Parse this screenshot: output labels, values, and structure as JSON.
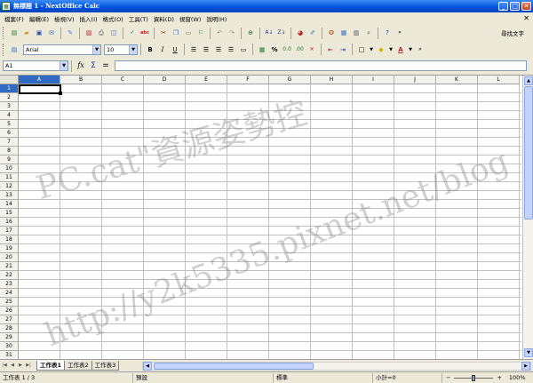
{
  "window": {
    "title": "無標題 1 - NextOffice Calc",
    "controls": [
      "_",
      "□",
      "✕"
    ]
  },
  "menu": {
    "items": [
      "檔案(F)",
      "編輯(E)",
      "檢視(V)",
      "插入(I)",
      "格式(O)",
      "工具(T)",
      "資料(D)",
      "視窗(W)",
      "說明(H)"
    ],
    "close": "✕"
  },
  "toolbar": {
    "standard_icons": [
      "new-doc",
      "open-folder",
      "save",
      "email",
      "edit-file",
      "export-pdf",
      "print",
      "print-preview",
      "spellcheck",
      "autospellcheck",
      "cut",
      "copy",
      "paste",
      "format-paintbrush",
      "undo",
      "redo",
      "hyperlink",
      "sort-ascending",
      "sort-descending",
      "chart",
      "draw-functions",
      "navigator",
      "gallery",
      "data-sources",
      "zoom",
      "help"
    ],
    "find_text": "尋找文字"
  },
  "formatting": {
    "font_name": "Arial",
    "font_size": "10",
    "bold": "B",
    "italic": "I",
    "underline": "U",
    "percent": "%",
    "icons": [
      "styles",
      "align-left",
      "align-center",
      "align-right",
      "justify",
      "merge-cells",
      "currency",
      "percent",
      "standard-number",
      "add-decimal",
      "delete-decimal",
      "decrease-indent",
      "increase-indent",
      "borders",
      "background-color",
      "font-color"
    ]
  },
  "formula_bar": {
    "cell_ref": "A1",
    "fx": "fx",
    "sigma": "Σ",
    "equals": "=",
    "content": ""
  },
  "grid": {
    "columns": [
      "A",
      "B",
      "C",
      "D",
      "E",
      "F",
      "G",
      "H",
      "I",
      "J",
      "K",
      "L"
    ],
    "rows": [
      "1",
      "2",
      "3",
      "4",
      "5",
      "6",
      "7",
      "8",
      "9",
      "10",
      "11",
      "12",
      "13",
      "14",
      "15",
      "16",
      "17",
      "18",
      "19",
      "20",
      "21",
      "22",
      "23",
      "24",
      "25",
      "26",
      "27",
      "28",
      "29",
      "30",
      "31"
    ],
    "active_cell": "A1"
  },
  "watermark": {
    "line1": "PC.cat\"資源姿勢控",
    "line2": "http://y2k5335.pixnet.net/blog"
  },
  "sheets": {
    "tabs": [
      "工作表1",
      "工作表2",
      "工作表3"
    ],
    "active": "工作表1"
  },
  "status": {
    "sheet": "工作表 1 / 3",
    "page_style": "預設",
    "mode": "標準",
    "sum": "小計=0",
    "zoom": "100%"
  }
}
